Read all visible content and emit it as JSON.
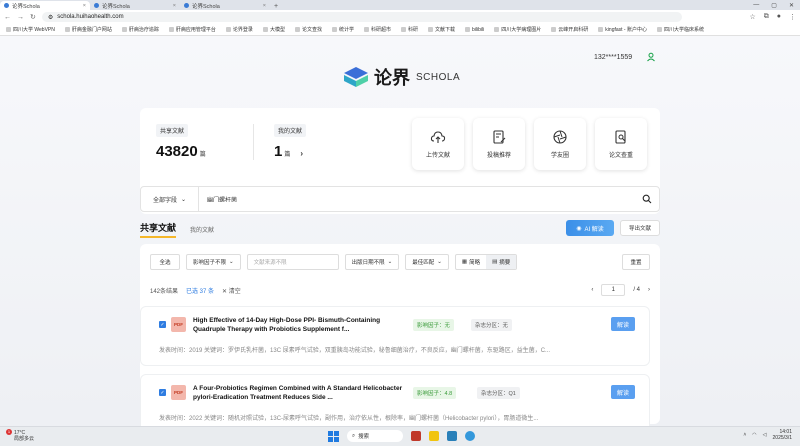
{
  "browser": {
    "tabs": [
      {
        "label": "论界Schola",
        "active": true
      },
      {
        "label": "论界Schola",
        "active": false
      },
      {
        "label": "论界Schola",
        "active": false
      }
    ],
    "url": "schola.huihaohealth.com",
    "bookmarks": [
      "四川大学 WebVPN",
      "肝病金融门户网站",
      "肝病治疗追踪",
      "肝病应用管理平台",
      "论界登录",
      "大模型",
      "论文查找",
      "统计学",
      "科研超市",
      "科研",
      "文献下载",
      "bilibili",
      "四川大学病理图片",
      "云峰开启科研",
      "kingfast - 账户中心",
      "四川大学临床系统"
    ]
  },
  "header": {
    "logo_text": "论界",
    "logo_sub": "SCHOLA",
    "user_phone": "132****1559"
  },
  "stats": {
    "shared_label": "共享文献",
    "shared_count": "43820",
    "shared_unit": "篇",
    "mine_label": "我的文献",
    "mine_count": "1",
    "mine_unit": "篇"
  },
  "quick_actions": [
    {
      "label": "上传文献",
      "icon": "upload-cloud-icon"
    },
    {
      "label": "投稿推荐",
      "icon": "document-edit-icon"
    },
    {
      "label": "学友圈",
      "icon": "aperture-icon"
    },
    {
      "label": "论文查重",
      "icon": "document-search-icon"
    }
  ],
  "search": {
    "scope": "全部字段",
    "value": "幽门螺杆菌"
  },
  "tabs": {
    "shared": "共享文献",
    "mine": "我的文献",
    "ai_button": "AI 解读",
    "export_button": "导出文献"
  },
  "filters": {
    "select_all": "全选",
    "impact_factor": "影响因子不限",
    "journal_placeholder": "文献来源不限",
    "year": "出版日期不限",
    "sort": "最佳匹配",
    "view_brief": "简略",
    "view_detail": "摘要",
    "reset": "重置"
  },
  "results_meta": {
    "total": "142条结果",
    "selected": "已选 37 条",
    "clear": "清空",
    "page": "1",
    "pages": "/ 4"
  },
  "results": [
    {
      "title": "High Effective of 14-Day High-Dose PPI- Bismuth-Containing Quadruple Therapy with Probiotics Supplement f...",
      "impact": "影响因子：无",
      "zone": "杂志分区：无",
      "read": "解读",
      "desc": "发表时间：2019  关键词：罗伊氏乳杆菌，13C 尿素呼气试验，双重胰岛功能试验，秘鲁细菌治疗，不良反应，幽门螺杆菌，东驱路区，益生菌，C..."
    },
    {
      "title": "A Four-Probiotics Regimen Combined with A Standard Helicobacter pylori-Eradication Treatment Reduces Side ...",
      "impact": "影响因子：4.8",
      "zone": "杂志分区：Q1",
      "read": "解读",
      "desc": "发表时间：2022  关键词：随机对照试验，13C-尿素呼气试验，副作用，治疗依从性，根除率，幽门螺杆菌（Helicobacter pylori），胃肠道微生..."
    }
  ],
  "taskbar": {
    "weather_temp": "17°C",
    "weather_desc": "局部多云",
    "search": "搜索",
    "time": "14:01",
    "date": "2025/3/1",
    "badge": "1"
  }
}
